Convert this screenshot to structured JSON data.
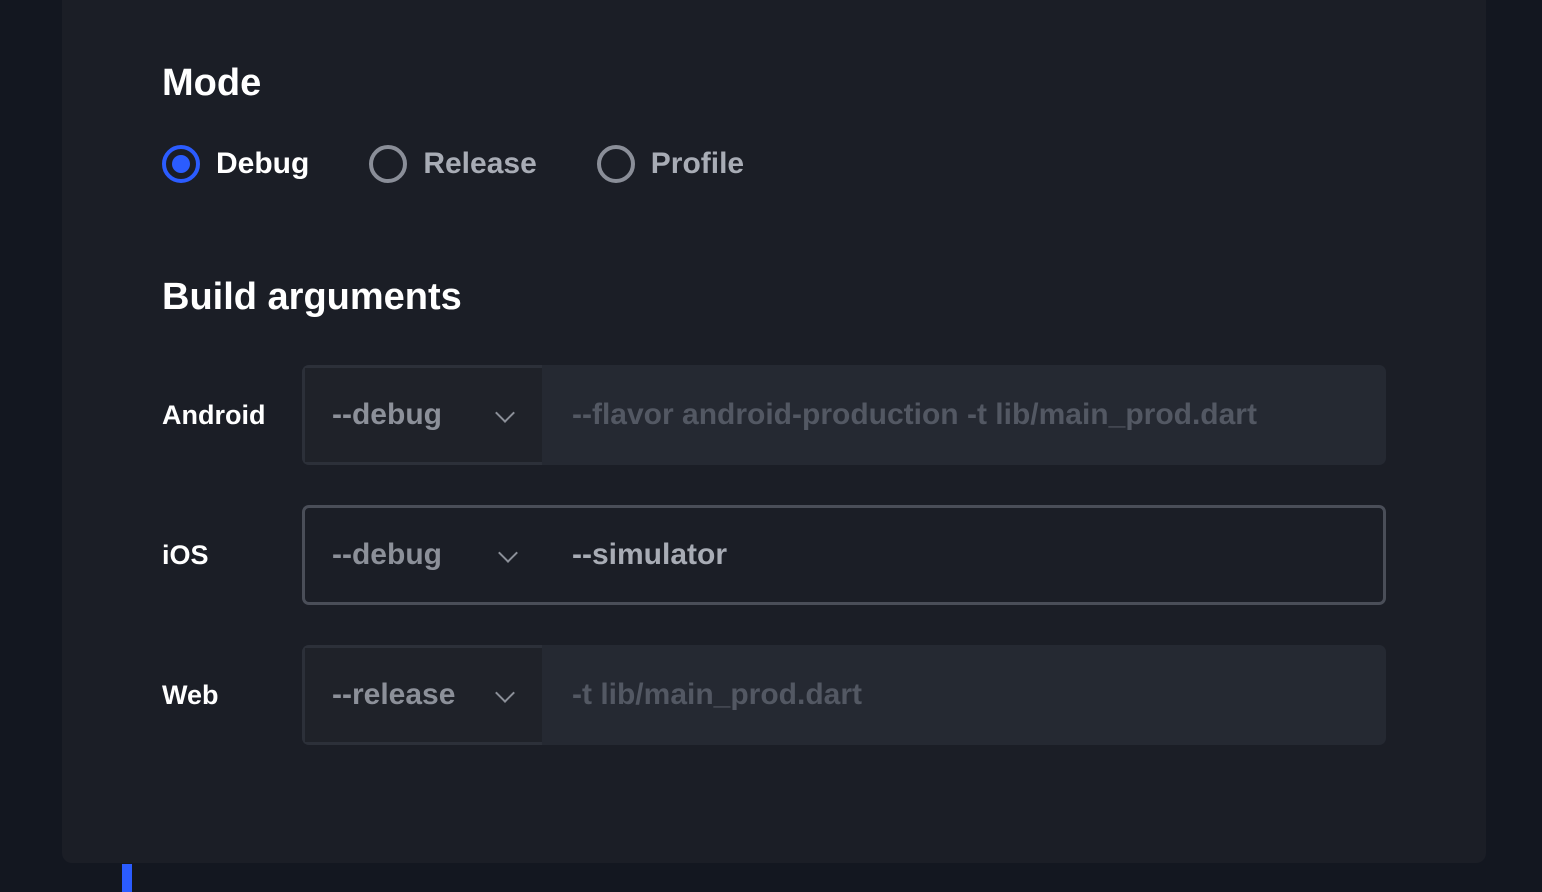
{
  "mode": {
    "title": "Mode",
    "options": [
      {
        "label": "Debug",
        "checked": true
      },
      {
        "label": "Release",
        "checked": false
      },
      {
        "label": "Profile",
        "checked": false
      }
    ]
  },
  "build_args": {
    "title": "Build arguments",
    "rows": [
      {
        "platform": "Android",
        "mode_value": "--debug",
        "args_value": "",
        "args_placeholder": "--flavor android-production -t lib/main_prod.dart"
      },
      {
        "platform": "iOS",
        "mode_value": "--debug",
        "args_value": "--simulator",
        "args_placeholder": ""
      },
      {
        "platform": "Web",
        "mode_value": "--release",
        "args_value": "",
        "args_placeholder": "-t lib/main_prod.dart"
      }
    ]
  },
  "colors": {
    "accent": "#2b5cff",
    "panel": "#1b1e26",
    "background": "#131720"
  },
  "icons": {
    "select_chevron": "chevron-down-icon"
  }
}
